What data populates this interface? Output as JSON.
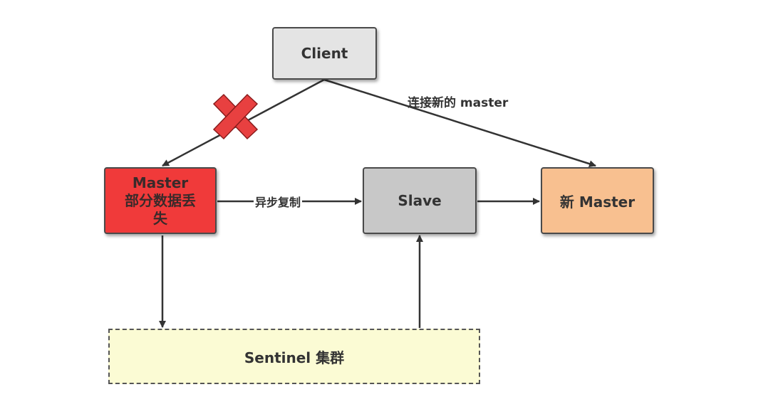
{
  "nodes": {
    "client": "Client",
    "master_line1": "Master",
    "master_line2": "部分数据丢",
    "master_line3": "失",
    "slave": "Slave",
    "new_master": "新 Master",
    "sentinel": "Sentinel 集群"
  },
  "edges": {
    "client_to_new_master": "连接新的 master",
    "master_to_slave": "异步复制"
  },
  "colors": {
    "client_fill": "#e4e4e4",
    "master_fill": "#f03a3a",
    "slave_fill": "#c8c8c8",
    "new_master_fill": "#f8c090",
    "sentinel_fill": "#fbfbd4",
    "cross_mark": "#e84040",
    "line": "#333333"
  },
  "icons": {
    "broken_connection": "red-cross-icon"
  }
}
